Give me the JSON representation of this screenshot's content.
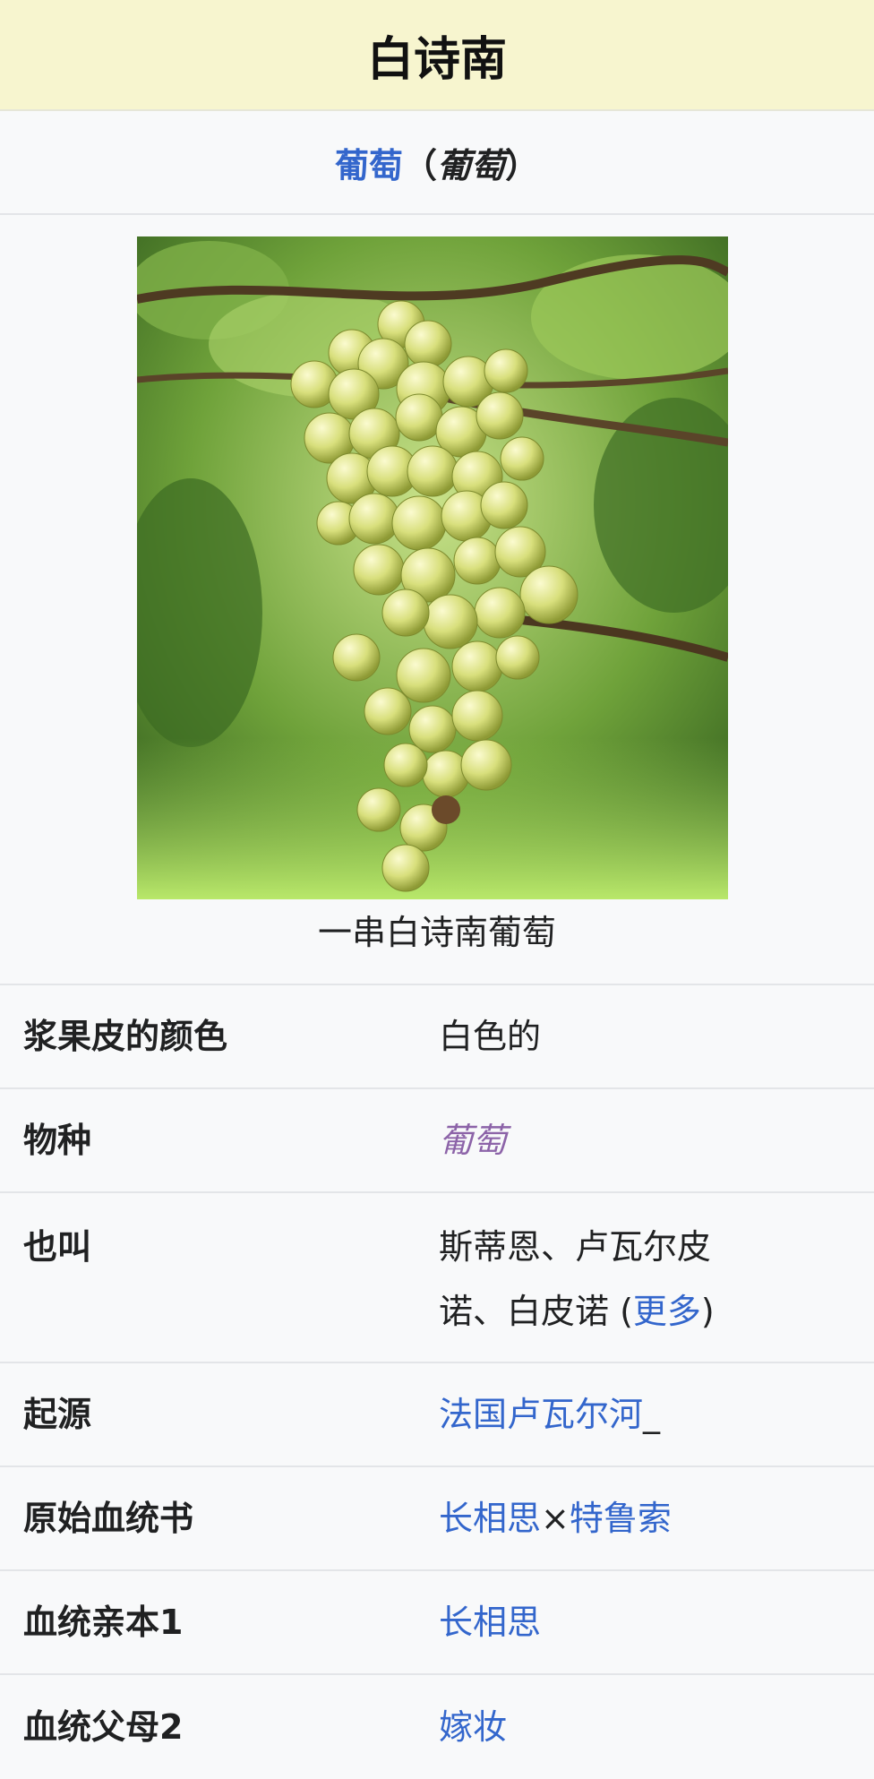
{
  "title": "白诗南",
  "species_header": {
    "link_text": "葡萄",
    "paren_open": "（",
    "italic_text": "葡萄",
    "paren_close": "）"
  },
  "image": {
    "caption": "一串白诗南葡萄"
  },
  "rows": [
    {
      "label": "浆果皮的颜色",
      "value": "白色的"
    },
    {
      "label": "物种",
      "value": "葡萄"
    },
    {
      "label": "也叫",
      "value_line1": "斯蒂恩、卢瓦尔皮",
      "value_line2_pre": "诺、白皮诺 (",
      "value_link": "更多",
      "value_line2_post": ")"
    },
    {
      "label": "起源",
      "value": "法国卢瓦尔河",
      "suffix": "_"
    },
    {
      "label": "原始血统书",
      "value_a": "长相思",
      "separator": "×",
      "value_b": "特鲁索"
    },
    {
      "label": "血统亲本1",
      "value": "长相思"
    },
    {
      "label": "血统父母2",
      "value": "嫁妆"
    }
  ]
}
